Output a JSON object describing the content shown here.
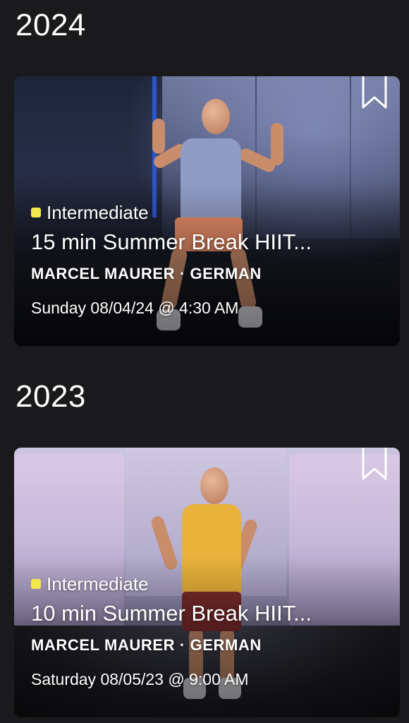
{
  "sections": [
    {
      "year": "2024",
      "card": {
        "level": "Intermediate",
        "title": "15 min Summer Break HIIT...",
        "instructor_line": "MARCEL MAURER · GERMAN",
        "datetime": "Sunday 08/04/24 @ 4:30 AM",
        "bookmark_icon": "bookmark-icon"
      }
    },
    {
      "year": "2023",
      "card": {
        "level": "Intermediate",
        "title": "10 min Summer Break HIIT...",
        "instructor_line": "MARCEL MAURER · GERMAN",
        "datetime": "Saturday 08/05/23 @ 9:00 AM",
        "bookmark_icon": "bookmark-icon"
      }
    }
  ],
  "colors": {
    "background": "#1a1a1d",
    "level_indicator": "#f4e84a",
    "text": "#ffffff"
  }
}
